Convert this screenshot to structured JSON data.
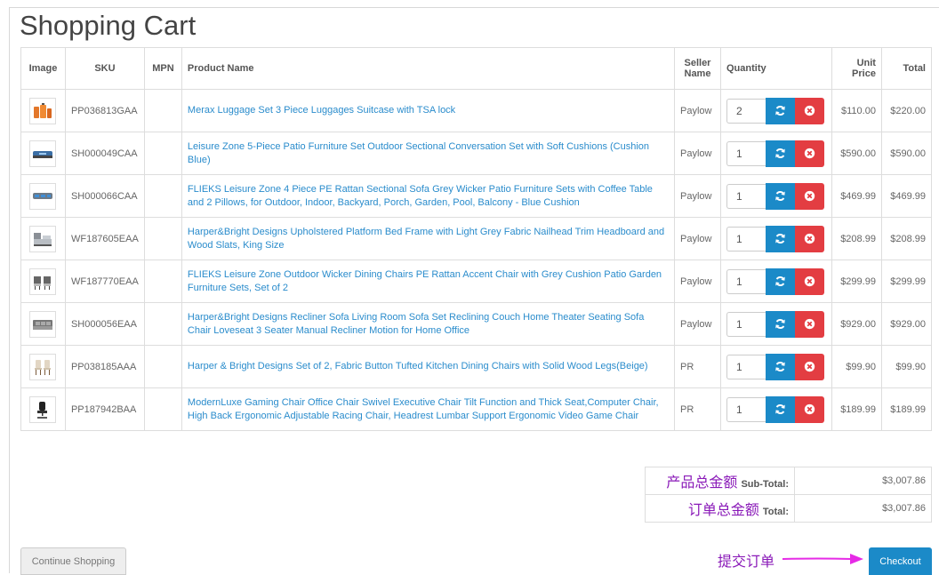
{
  "page": {
    "title": "Shopping Cart"
  },
  "table": {
    "headers": {
      "image": "Image",
      "sku": "SKU",
      "mpn": "MPN",
      "product_name": "Product Name",
      "seller_name": "Seller Name",
      "quantity": "Quantity",
      "unit_price": "Unit Price",
      "total": "Total"
    },
    "rows": [
      {
        "sku": "PP036813GAA",
        "mpn": "",
        "name": "Merax Luggage Set 3 Piece Luggages Suitcase with TSA lock",
        "seller": "Paylow",
        "qty": "2",
        "unit": "$110.00",
        "total": "$220.00",
        "icon": "luggage-icon"
      },
      {
        "sku": "SH000049CAA",
        "mpn": "",
        "name": "Leisure Zone 5-Piece Patio Furniture Set Outdoor Sectional Conversation Set with Soft Cushions (Cushion Blue)",
        "seller": "Paylow",
        "qty": "1",
        "unit": "$590.00",
        "total": "$590.00",
        "icon": "patio-set-icon"
      },
      {
        "sku": "SH000066CAA",
        "mpn": "",
        "name": "FLIEKS Leisure Zone 4 Piece PE Rattan Sectional Sofa Grey Wicker Patio Furniture Sets with Coffee Table and 2 Pillows, for Outdoor, Indoor, Backyard, Porch, Garden, Pool, Balcony - Blue Cushion",
        "seller": "Paylow",
        "qty": "1",
        "unit": "$469.99",
        "total": "$469.99",
        "icon": "sofa-set-icon"
      },
      {
        "sku": "WF187605EAA",
        "mpn": "",
        "name": "Harper&Bright Designs Upholstered Platform Bed Frame with Light Grey Fabric Nailhead Trim Headboard and Wood Slats, King Size",
        "seller": "Paylow",
        "qty": "1",
        "unit": "$208.99",
        "total": "$208.99",
        "icon": "bed-icon"
      },
      {
        "sku": "WF187770EAA",
        "mpn": "",
        "name": "FLIEKS Leisure Zone Outdoor Wicker Dining Chairs PE Rattan Accent Chair with Grey Cushion Patio Garden Furniture Sets, Set of 2",
        "seller": "Paylow",
        "qty": "1",
        "unit": "$299.99",
        "total": "$299.99",
        "icon": "wicker-chairs-icon"
      },
      {
        "sku": "SH000056EAA",
        "mpn": "",
        "name": "Harper&Bright Designs Recliner Sofa Living Room Sofa Set Reclining Couch Home Theater Seating Sofa Chair Loveseat 3 Seater Manual Recliner Motion for Home Office",
        "seller": "Paylow",
        "qty": "1",
        "unit": "$929.00",
        "total": "$929.00",
        "icon": "recliner-sofa-icon"
      },
      {
        "sku": "PP038185AAA",
        "mpn": "",
        "name": "Harper & Bright Designs Set of 2, Fabric Button Tufted Kitchen Dining Chairs with Solid Wood Legs(Beige)",
        "seller": "PR",
        "qty": "1",
        "unit": "$99.90",
        "total": "$99.90",
        "icon": "dining-chairs-icon"
      },
      {
        "sku": "PP187942BAA",
        "mpn": "",
        "name": "ModernLuxe Gaming Chair Office Chair Swivel Executive Chair Tilt Function and Thick Seat,Computer Chair, High Back Ergonomic Adjustable Racing Chair, Headrest Lumbar Support Ergonomic Video Game Chair",
        "seller": "PR",
        "qty": "1",
        "unit": "$189.99",
        "total": "$189.99",
        "icon": "gaming-chair-icon"
      }
    ]
  },
  "totals": {
    "subtotal": {
      "note": "产品总金额",
      "label": "Sub-Total:",
      "value": "$3,007.86"
    },
    "total": {
      "note": "订单总金额",
      "label": "Total:",
      "value": "$3,007.86"
    }
  },
  "actions": {
    "continue_label": "Continue Shopping",
    "checkout_label": "Checkout",
    "checkout_note": "提交订单"
  },
  "colors": {
    "link": "#2a8ccc",
    "refresh": "#1b8ac8",
    "remove": "#e33d42",
    "annotation": "#8a1ab8",
    "arrow": "#e62ae6"
  }
}
